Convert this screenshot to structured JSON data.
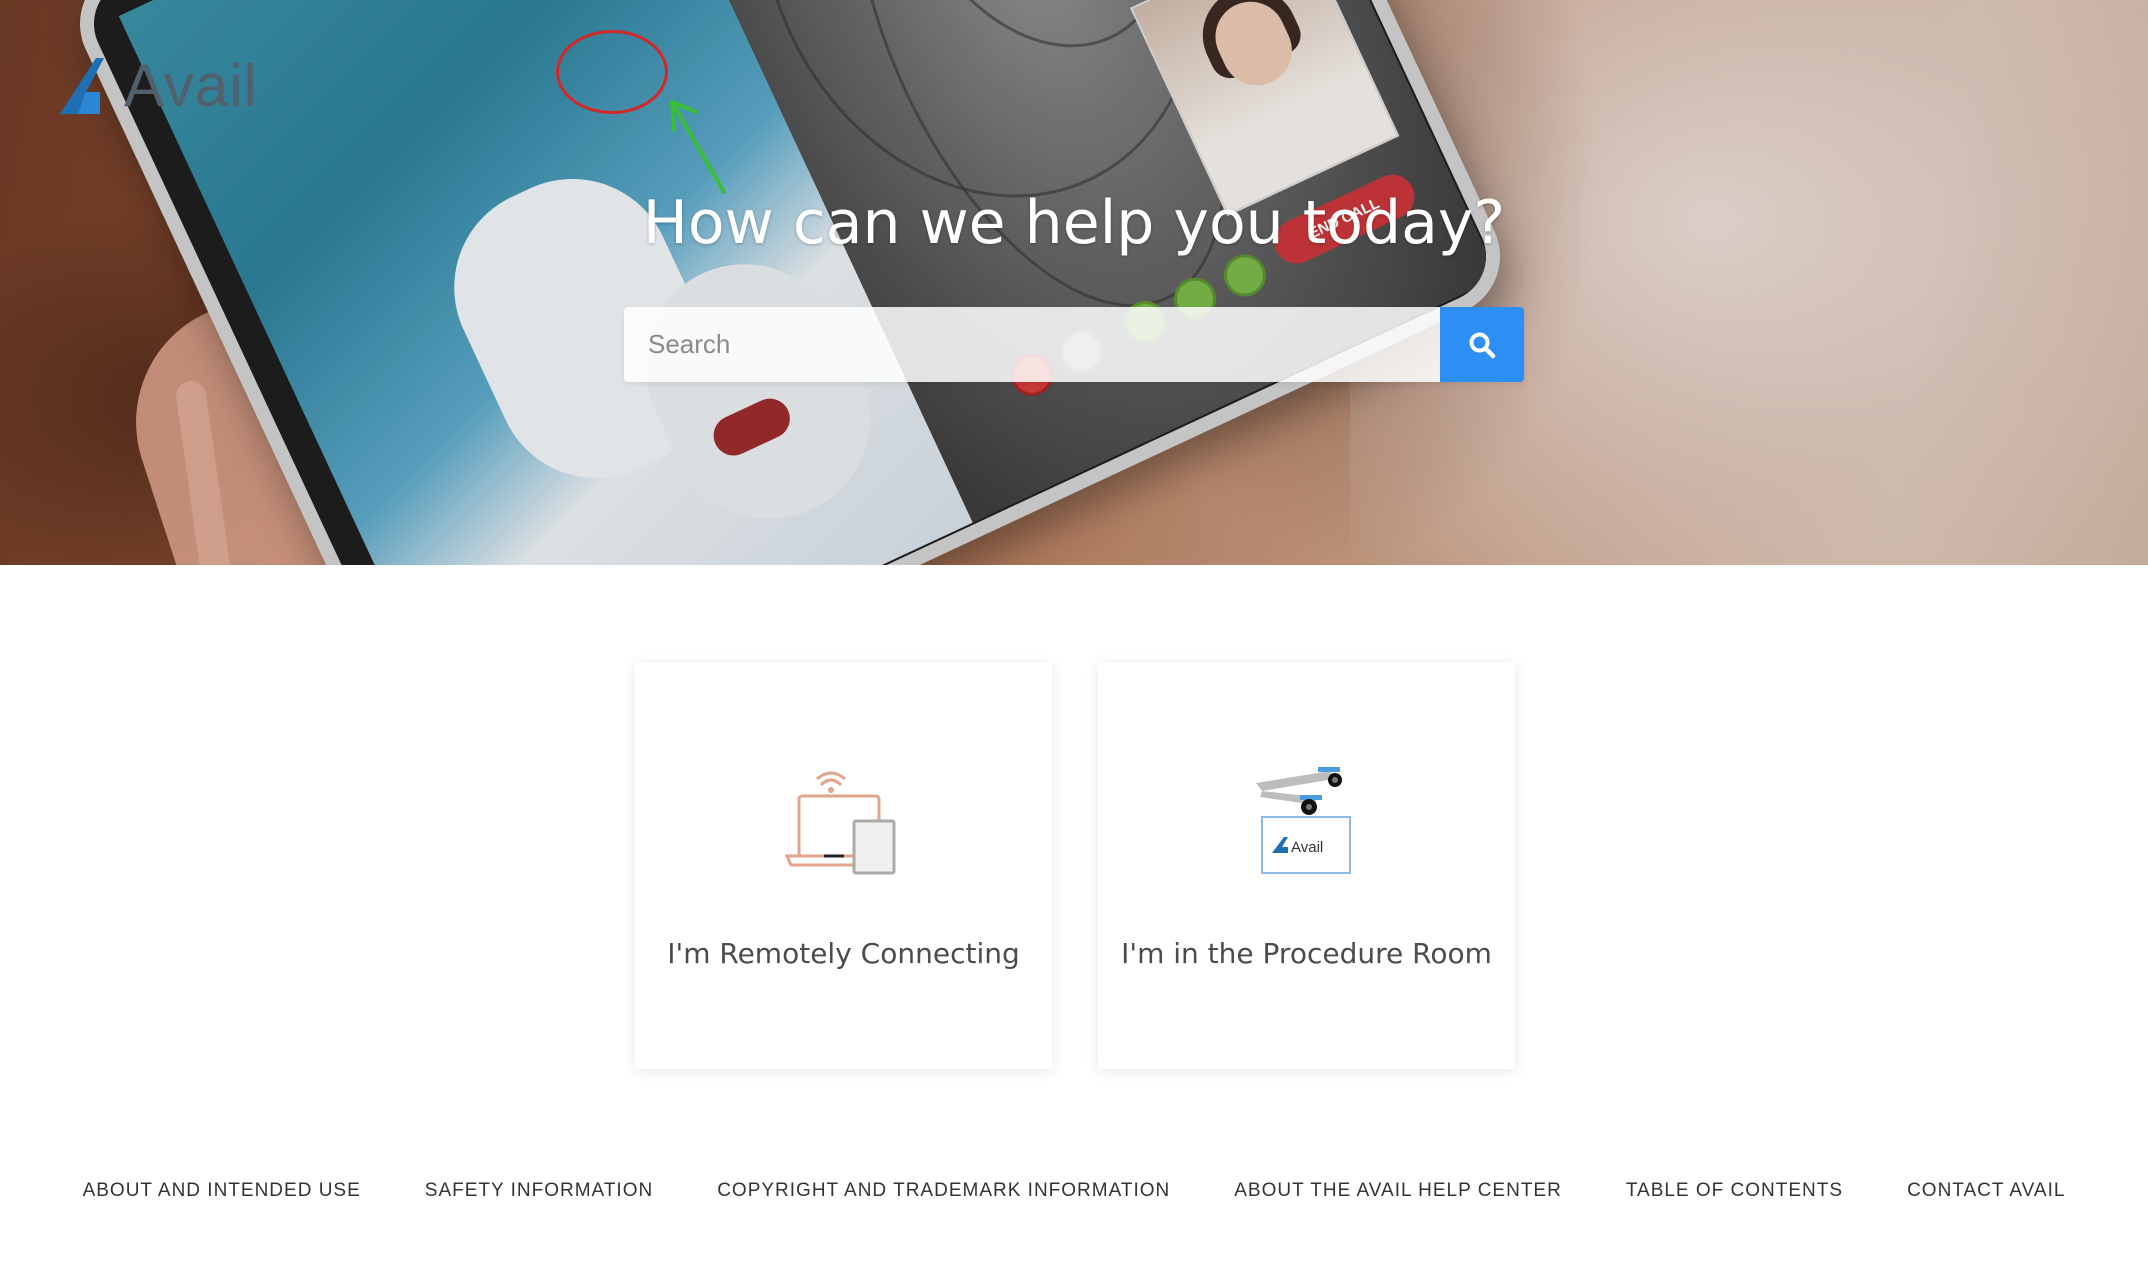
{
  "brand": {
    "name": "Avail",
    "logo_color": "#1f6fb5",
    "text_color": "#51606c"
  },
  "hero": {
    "title": "How can we help you today?",
    "image_overlay": {
      "end_call_label": "END CALL"
    }
  },
  "search": {
    "placeholder": "Search",
    "value": "",
    "button_icon": "search-icon",
    "button_color": "#2d8ef5"
  },
  "cards": [
    {
      "label": "I'm Remotely Connecting",
      "icon": "remote-devices-icon"
    },
    {
      "label": "I'm in the Procedure Room",
      "icon": "procedure-room-device-icon",
      "icon_badge": "Avail"
    }
  ],
  "footer": {
    "links": [
      "ABOUT AND INTENDED USE",
      "SAFETY INFORMATION",
      "COPYRIGHT AND TRADEMARK INFORMATION",
      "ABOUT THE AVAIL HELP CENTER",
      "TABLE OF CONTENTS",
      "CONTACT AVAIL"
    ]
  }
}
